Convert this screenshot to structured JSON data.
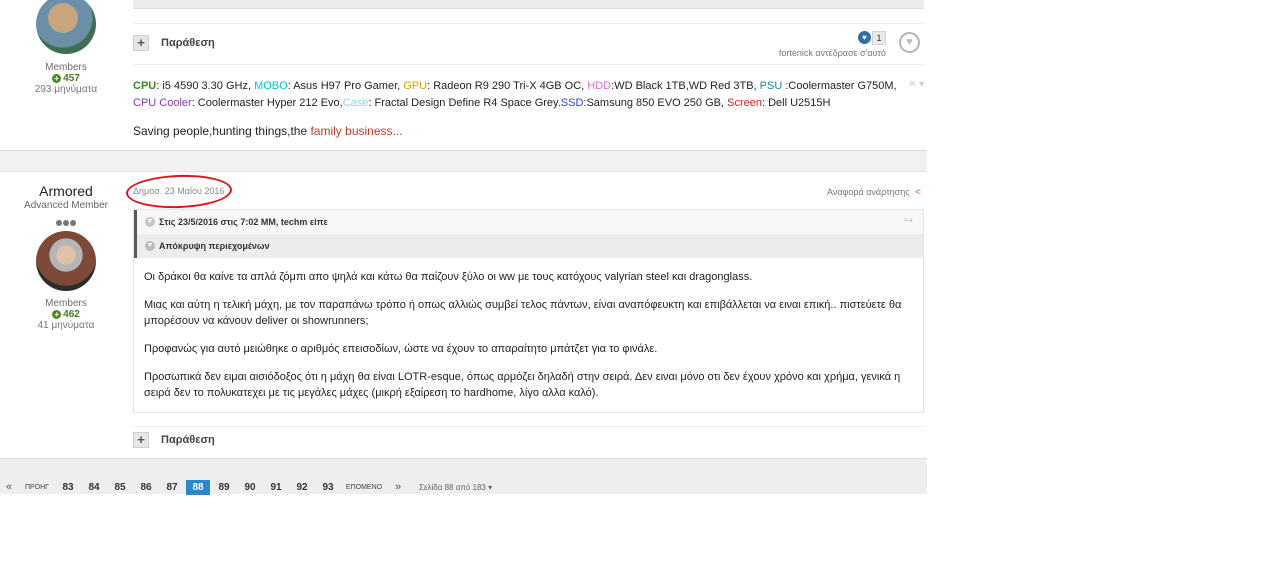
{
  "post1": {
    "group": "Members",
    "reputation": "457",
    "post_count": "293 μηνύματα",
    "quote_label": "Παράθεση",
    "reaction_count": "1",
    "reaction_by": "fortenick αντέδρασε σ'αυτό",
    "signature": {
      "cpu_key": "CPU",
      "cpu_val": ": i5 4590 3.30 GHz, ",
      "mobo_key": "MOBO",
      "mobo_val": ": Asus H97 Pro Gamer, ",
      "gpu_key": "GPU",
      "gpu_val": ": Radeon R9 290 Tri-X 4GB OC, ",
      "hdd_key": "HDD",
      "hdd_val": ":WD Black 1TB,WD Red 3TB, ",
      "psu_key": "PSU",
      "psu_val": " :Coolermaster G750M, ",
      "cooler_key": "CPU Cooler",
      "cooler_val": ": Coolermaster Hyper 212 Evo,",
      "case_key": "Case",
      "case_val": ": Fractal Design Define R4 Space Grey.",
      "ssd_key": "SSD",
      "ssd_val": ":Samsung 850 EVO 250 GB, ",
      "screen_key": "Screen",
      "screen_val": ": Dell U2515H"
    },
    "saying_plain": "Saving people,hunting things,the ",
    "saying_red": "family business..."
  },
  "post2": {
    "username": "Armored",
    "user_title": "Advanced Member",
    "group": "Members",
    "reputation": "462",
    "post_count": "41 μηνύματα",
    "date": "Δημοσ. 23 Μαΐου 2016",
    "report": "Αναφορά ανάρτησης",
    "quote_header": "Στις 23/5/2016 στις 7:02 ΜΜ, techm είπε",
    "spoiler_label": "Απόκρυψη περιεχομένων",
    "paragraphs": [
      "Οι δράκοι θα καίνε τα απλά ζόμπι απο ψηλά και κάτω θα παίζουν ξύλο οι ww με τους κατόχους valyrian steel και dragonglass.",
      "Μιας και αύτη η τελική μάχη, με τον παραπάνω τρόπο ή οπως αλλιώς συμβεί τελος πάντων, είναι αναπόφευκτη και επιβάλλεται να ειναι επική.. πιστεύετε θα μπορέσουν να κάνουν deliver οι showrunners;",
      "Προφανώς για αυτό μειώθηκε ο αριθμός επεισοδίων, ώστε να έχουν το απαραίτητο μπάτζετ για το φινάλε.",
      "Προσωπικά δεν ειμαι αισιόδοξος ότι η μάχη θα είναι LOTR-esque, όπως αρμόζει δηλαδή στην σειρά. Δεν ειναι μόνο οτι δεν έχουν χρόνο και χρήμα, γενικά η σειρά δεν το πολυκατεχει με τις μεγάλες μάχες (μικρή εξαίρεση το hardhome, λίγο αλλα καλό)."
    ],
    "quote_label": "Παράθεση"
  },
  "pagination": {
    "first": "«",
    "prev": "ΠΡΟΗΓ",
    "pages": [
      "83",
      "84",
      "85",
      "86",
      "87",
      "88",
      "89",
      "90",
      "91",
      "92",
      "93"
    ],
    "active": "88",
    "next": "ΕΠΟΜΕΝΟ",
    "last": "»",
    "page_of": "Σελίδα 88 από 183"
  },
  "colors": {
    "cpu": "#2e8b1e",
    "mobo": "#00c4d8",
    "gpu": "#e0a000",
    "hdd": "#e070e0",
    "psu": "#1a8aa0",
    "cooler": "#8a3aa8",
    "case": "#8fd0e8",
    "ssd": "#2b3fd0",
    "screen": "#d02020",
    "active_page": "#2a87c9",
    "annotation": "#e0141e"
  }
}
